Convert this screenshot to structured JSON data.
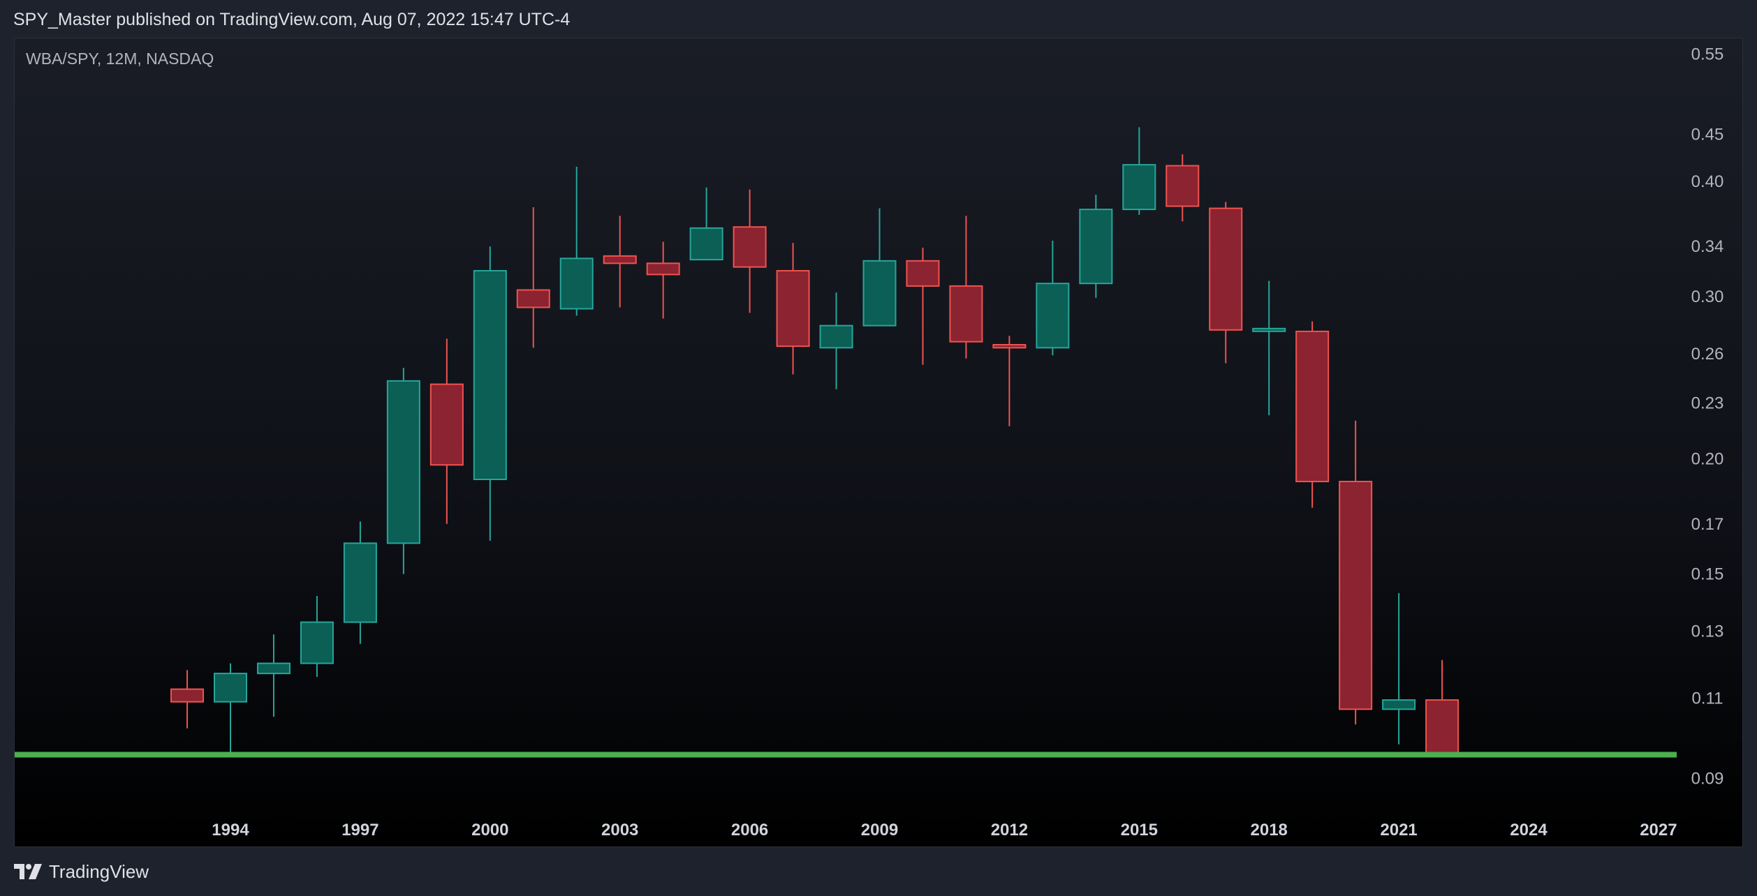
{
  "header": {
    "published": "SPY_Master published on TradingView.com, Aug 07, 2022 15:47 UTC-4"
  },
  "chart": {
    "symbol_label": "WBA/SPY, 12M, NASDAQ"
  },
  "footer": {
    "brand": "TradingView"
  },
  "colors": {
    "up": "#26a69a",
    "up_fill": "#0b5f55",
    "down": "#ef5350",
    "down_fill": "#8b2330",
    "support_line": "#4caf50",
    "axis_text": "#b2b5be",
    "time_axis_text": "#d1d4dc"
  },
  "chart_data": {
    "type": "candlestick",
    "y_scale": "log",
    "ylim": [
      0.0855,
      0.56
    ],
    "xlim": [
      1989.3,
      2028.2
    ],
    "y_ticks": [
      0.55,
      0.45,
      0.4,
      0.34,
      0.3,
      0.26,
      0.23,
      0.2,
      0.17,
      0.15,
      0.13,
      0.11,
      0.09
    ],
    "x_ticks": [
      "1994",
      "1997",
      "2000",
      "2003",
      "2006",
      "2009",
      "2012",
      "2015",
      "2018",
      "2021",
      "2024",
      "2027"
    ],
    "horizontal_lines": [
      0.0955
    ],
    "candles": [
      {
        "year": 1993,
        "open": 0.1125,
        "close": 0.109,
        "high": 0.118,
        "low": 0.102
      },
      {
        "year": 1994,
        "open": 0.109,
        "close": 0.117,
        "high": 0.12,
        "low": 0.0955
      },
      {
        "year": 1995,
        "open": 0.117,
        "close": 0.12,
        "high": 0.129,
        "low": 0.105
      },
      {
        "year": 1996,
        "open": 0.12,
        "close": 0.133,
        "high": 0.142,
        "low": 0.116
      },
      {
        "year": 1997,
        "open": 0.133,
        "close": 0.162,
        "high": 0.171,
        "low": 0.126
      },
      {
        "year": 1998,
        "open": 0.162,
        "close": 0.243,
        "high": 0.251,
        "low": 0.15
      },
      {
        "year": 1999,
        "open": 0.241,
        "close": 0.197,
        "high": 0.27,
        "low": 0.17
      },
      {
        "year": 2000,
        "open": 0.19,
        "close": 0.32,
        "high": 0.34,
        "low": 0.163
      },
      {
        "year": 2001,
        "open": 0.305,
        "close": 0.292,
        "high": 0.375,
        "low": 0.264
      },
      {
        "year": 2002,
        "open": 0.291,
        "close": 0.33,
        "high": 0.415,
        "low": 0.286
      },
      {
        "year": 2003,
        "open": 0.332,
        "close": 0.326,
        "high": 0.367,
        "low": 0.292
      },
      {
        "year": 2004,
        "open": 0.326,
        "close": 0.317,
        "high": 0.344,
        "low": 0.284
      },
      {
        "year": 2005,
        "open": 0.329,
        "close": 0.356,
        "high": 0.394,
        "low": 0.329
      },
      {
        "year": 2006,
        "open": 0.357,
        "close": 0.323,
        "high": 0.392,
        "low": 0.288
      },
      {
        "year": 2007,
        "open": 0.32,
        "close": 0.265,
        "high": 0.343,
        "low": 0.247
      },
      {
        "year": 2008,
        "open": 0.264,
        "close": 0.279,
        "high": 0.303,
        "low": 0.238
      },
      {
        "year": 2009,
        "open": 0.279,
        "close": 0.328,
        "high": 0.374,
        "low": 0.279
      },
      {
        "year": 2010,
        "open": 0.328,
        "close": 0.308,
        "high": 0.339,
        "low": 0.253
      },
      {
        "year": 2011,
        "open": 0.308,
        "close": 0.268,
        "high": 0.367,
        "low": 0.257
      },
      {
        "year": 2012,
        "open": 0.266,
        "close": 0.264,
        "high": 0.272,
        "low": 0.217
      },
      {
        "year": 2013,
        "open": 0.264,
        "close": 0.31,
        "high": 0.345,
        "low": 0.259
      },
      {
        "year": 2014,
        "open": 0.31,
        "close": 0.373,
        "high": 0.387,
        "low": 0.299
      },
      {
        "year": 2015,
        "open": 0.373,
        "close": 0.417,
        "high": 0.458,
        "low": 0.368
      },
      {
        "year": 2016,
        "open": 0.416,
        "close": 0.376,
        "high": 0.428,
        "low": 0.362
      },
      {
        "year": 2017,
        "open": 0.374,
        "close": 0.276,
        "high": 0.38,
        "low": 0.254
      },
      {
        "year": 2018,
        "open": 0.276,
        "close": 0.276,
        "high": 0.312,
        "low": 0.223
      },
      {
        "year": 2019,
        "open": 0.275,
        "close": 0.189,
        "high": 0.282,
        "low": 0.177
      },
      {
        "year": 2020,
        "open": 0.189,
        "close": 0.107,
        "high": 0.22,
        "low": 0.103
      },
      {
        "year": 2021,
        "open": 0.107,
        "close": 0.1095,
        "high": 0.143,
        "low": 0.098
      },
      {
        "year": 2022,
        "open": 0.1095,
        "close": 0.0955,
        "high": 0.121,
        "low": 0.0955
      }
    ]
  }
}
